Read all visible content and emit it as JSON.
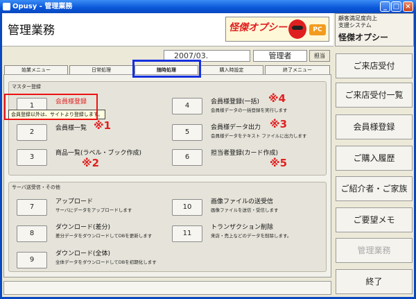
{
  "window": {
    "title": "Opusy - 管理業務"
  },
  "header": {
    "page_title": "管理業務",
    "logo_text": "怪傑オプシー",
    "logo_pc": "PC"
  },
  "system": {
    "line1": "顧客満足度向上",
    "line2": "支援システム",
    "name": "怪傑オプシー"
  },
  "info": {
    "date": "2007/03.",
    "user": "管理者",
    "role_button": "担当"
  },
  "tabs": [
    "始業メニュー",
    "日常処理",
    "随時処理",
    "購入時設定",
    "終了メニュー"
  ],
  "master": {
    "title": "マスター登録",
    "items": [
      {
        "num": "1",
        "label": "会員様登録",
        "desc": ""
      },
      {
        "num": "2",
        "label": "会員様一覧",
        "desc": "",
        "mark": "※1"
      },
      {
        "num": "3",
        "label": "商品一覧(ラベル・ブック作成)",
        "desc": "",
        "mark": "※2"
      },
      {
        "num": "4",
        "label": "会員様登録(一括)",
        "desc": "会員様データの一括登録を実行します",
        "mark": "※4"
      },
      {
        "num": "5",
        "label": "会員様データ出力",
        "desc": "会員様データをテキスト ファイルに出力します",
        "mark": "※3"
      },
      {
        "num": "6",
        "label": "担当者登録(カード作成)",
        "desc": "",
        "mark": "※5"
      }
    ],
    "tooltip": "会員登録以外は、サイトより登録します。"
  },
  "server": {
    "title": "サーバ送受信・その他",
    "items": [
      {
        "num": "7",
        "label": "アップロード",
        "desc": "サーバにデータをアップロードします"
      },
      {
        "num": "8",
        "label": "ダウンロード(差分)",
        "desc": "差分データをダウンロードしてDBを更新します"
      },
      {
        "num": "9",
        "label": "ダウンロード(全体)",
        "desc": "全体データをダウンロードしてDBを初期化します"
      },
      {
        "num": "10",
        "label": "画像ファイルの送受信",
        "desc": "画像ファイルを送信・受信します"
      },
      {
        "num": "11",
        "label": "トランザクション削除",
        "desc": "来店・売上などのデータを削除します。"
      }
    ]
  },
  "nav": [
    "ご来店受付",
    "ご来店受付一覧",
    "会員様登録",
    "ご購入履歴",
    "ご紹介者・ご家族",
    "ご要望メモ",
    "管理業務",
    "終了"
  ],
  "colors": {
    "highlight": "#1530e0",
    "annotation": "#e02020"
  }
}
